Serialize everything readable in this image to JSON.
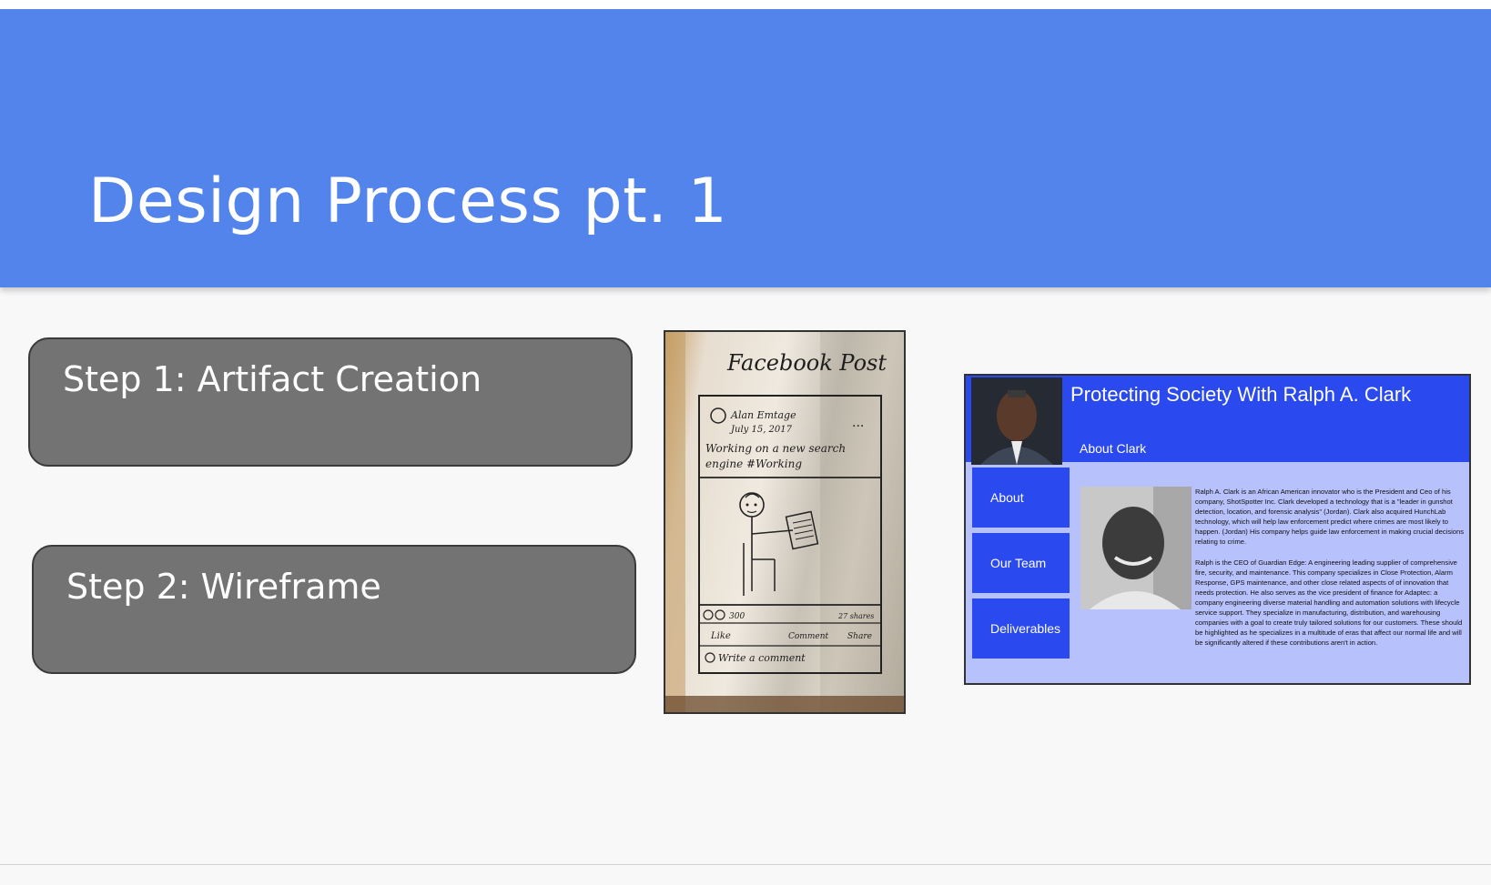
{
  "slide": {
    "title": "Design Process pt. 1"
  },
  "steps": [
    {
      "label": "Step 1: Artifact Creation"
    },
    {
      "label": "Step 2: Wireframe"
    }
  ],
  "sketch": {
    "heading": "Facebook Post",
    "author": "Alan Emtage",
    "date": "July 15, 2017",
    "post_text_1": "Working on a new search",
    "post_text_2": "engine #Working",
    "reactions": "300",
    "shares": "27 shares",
    "like": "Like",
    "comment": "Comment",
    "share": "Share",
    "write_comment": "Write a comment"
  },
  "mockup": {
    "title": "Protecting Society With Ralph A. Clark",
    "subtitle": "About Clark",
    "nav": [
      "About",
      "Our Team",
      "Deliverables"
    ],
    "paragraph_1": "Ralph A. Clark is an African American innovator who is the President and Ceo of his company, ShotSpotter Inc. Clark developed a technology that is a \"leader in gunshot detection, location, and forensic analysis\" (Jordan). Clark also acquired HunchLab technology, which will help law enforcement predict where crimes are most likely to happen. (Jordan) His company helps guide law enforcement in making crucial decisions relating to crime.",
    "paragraph_2": "Ralph is the CEO of Guardian Edge: A engineering leading supplier of comprehensive fire, security, and maintenance. This company specializes in Close Protection, Alarm Response, GPS maintenance, and other close related aspects of of innovation that needs protection. He also serves as the vice president of finance for Adaptec: a company engineering diverse material handling and automation solutions with lifecycle service support. They specialize in manufacturing, distribution, and warehousing companies with a goal to create truly tailored solutions for our customers. These should be highlighted as he specializes in a multitude of eras that affect our normal life and will be significantly altered if these contributions aren't in action."
  },
  "colors": {
    "header": "#5384ec",
    "step_box": "#737373",
    "mock_blue": "#2a49ee",
    "mock_light": "#b7c1fb"
  }
}
